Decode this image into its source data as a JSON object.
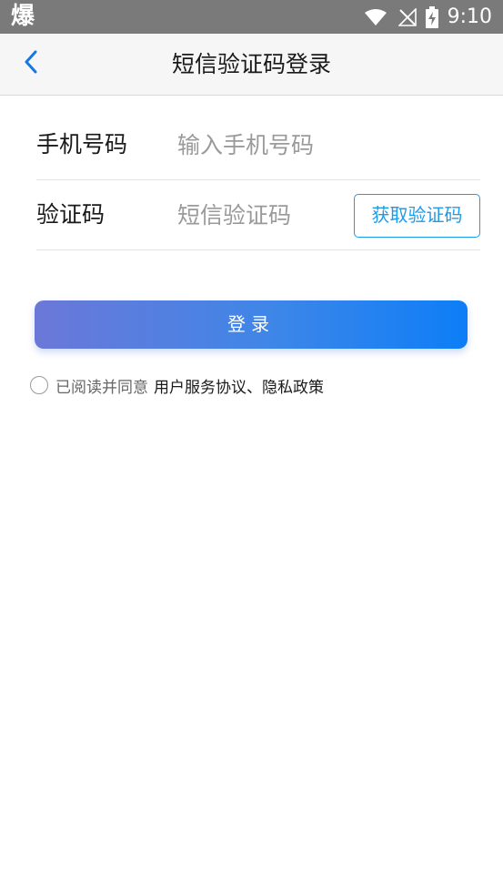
{
  "status_bar": {
    "app_icon_char": "爆",
    "time": "9:10",
    "icons": [
      "wifi-icon",
      "signal-off-icon",
      "battery-charging-icon"
    ]
  },
  "header": {
    "title": "短信验证码登录",
    "back_icon": "chevron-left-icon"
  },
  "form": {
    "phone": {
      "label": "手机号码",
      "placeholder": "输入手机号码",
      "value": ""
    },
    "code": {
      "label": "验证码",
      "placeholder": "短信验证码",
      "value": "",
      "get_code_button": "获取验证码"
    }
  },
  "login_button": "登录",
  "agreement": {
    "checked": false,
    "prefix": "已阅读并同意",
    "user_agreement": "用户服务协议",
    "separator": "、",
    "privacy_policy": "隐私政策"
  },
  "colors": {
    "accent": "#1e9be8",
    "status_bar_bg": "#7a7a7a",
    "header_bg": "#f6f6f6",
    "button_gradient_start": "#6b78d8",
    "button_gradient_end": "#0d7ef7"
  }
}
